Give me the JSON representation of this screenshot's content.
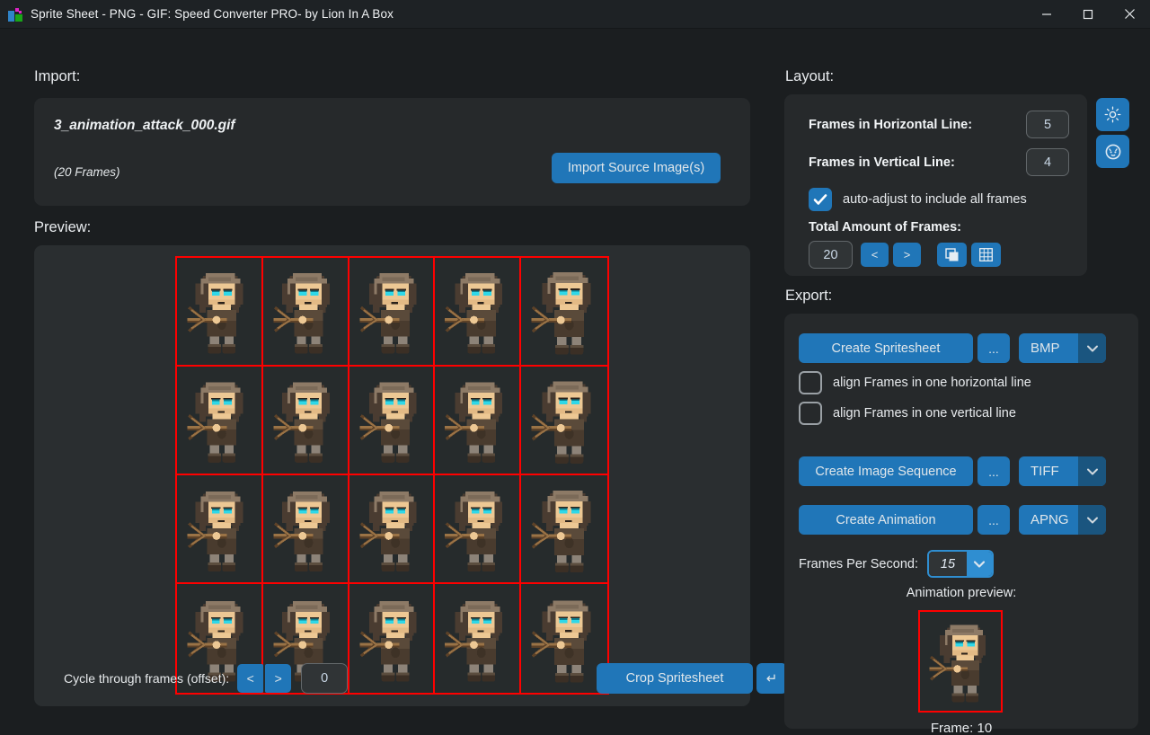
{
  "window": {
    "title": "Sprite Sheet - PNG - GIF: Speed Converter PRO- by Lion In A Box",
    "app_icon": "spritesheet-app-icon",
    "minimize_icon": "minimize-icon",
    "maximize_icon": "maximize-icon",
    "close_icon": "close-icon",
    "accent_blue": "#2076b8",
    "panel_bg": "#26292b",
    "window_bg": "#1b1e20",
    "grid_outline": "#fe0000"
  },
  "import": {
    "label": "Import:",
    "filename": "3_animation_attack_000.gif",
    "frames_info": "(20 Frames)",
    "button": "Import Source Image(s)"
  },
  "preview": {
    "label": "Preview:",
    "cycle_label": "Cycle through frames (offset):",
    "cycle_prev": "<",
    "cycle_next": ">",
    "offset_value": "0",
    "crop_button": "Crop Spritesheet",
    "crop_reset_icon": "undo-arrow-icon",
    "columns": 5,
    "rows": 4,
    "cells": 20
  },
  "layout": {
    "label": "Layout:",
    "horizontal_label": "Frames in Horizontal Line:",
    "horizontal_value": "5",
    "vertical_label": "Frames in Vertical Line:",
    "vertical_value": "4",
    "autoadjust_label": "auto-adjust to include all frames",
    "autoadjust_checked": true,
    "total_label": "Total Amount of Frames:",
    "total_value": "20",
    "total_prev": "<",
    "total_next": ">",
    "single_frame_icon": "single-frame-icon",
    "grid_frames_icon": "grid-frames-icon",
    "side_icons": [
      {
        "name": "brightness-sun-icon"
      },
      {
        "name": "lion-logo-icon"
      }
    ]
  },
  "export": {
    "label": "Export:",
    "rows": [
      {
        "button": "Create Spritesheet",
        "dots": "...",
        "format": "BMP",
        "arrow_icon": "chevron-down-icon"
      },
      {
        "button": "Create Image Sequence",
        "dots": "...",
        "format": "TIFF",
        "arrow_icon": "chevron-down-icon"
      },
      {
        "button": "Create Animation",
        "dots": "...",
        "format": "APNG",
        "arrow_icon": "chevron-down-icon"
      }
    ],
    "checkboxes": [
      {
        "label": "align Frames in one horizontal line",
        "checked": false
      },
      {
        "label": "align Frames in one vertical line",
        "checked": false
      }
    ],
    "fps_label": "Frames Per Second:",
    "fps_value": "15",
    "fps_arrow_icon": "chevron-down-icon",
    "anim_preview_label": "Animation preview:",
    "frame_label": "Frame: 10"
  }
}
